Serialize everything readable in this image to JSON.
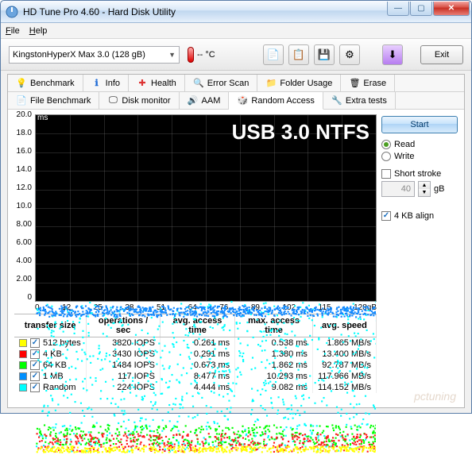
{
  "window": {
    "title": "HD Tune Pro 4.60 - Hard Disk Utility"
  },
  "menu": {
    "file": "File",
    "help": "Help"
  },
  "toolbar": {
    "device": "KingstonHyperX Max 3.0 (128 gB)",
    "temp": "-- °C",
    "exit": "Exit"
  },
  "tabs_row1": [
    {
      "id": "benchmark",
      "label": "Benchmark"
    },
    {
      "id": "info",
      "label": "Info"
    },
    {
      "id": "health",
      "label": "Health"
    },
    {
      "id": "errorscan",
      "label": "Error Scan"
    },
    {
      "id": "folderusage",
      "label": "Folder Usage"
    },
    {
      "id": "erase",
      "label": "Erase"
    }
  ],
  "tabs_row2": [
    {
      "id": "filebench",
      "label": "File Benchmark"
    },
    {
      "id": "diskmon",
      "label": "Disk monitor"
    },
    {
      "id": "aam",
      "label": "AAM"
    },
    {
      "id": "random",
      "label": "Random Access",
      "active": true
    },
    {
      "id": "extra",
      "label": "Extra tests"
    }
  ],
  "side": {
    "start": "Start",
    "read": "Read",
    "write": "Write",
    "short_stroke": "Short stroke",
    "stroke_val": "40",
    "stroke_unit": "gB",
    "align": "4 KB align"
  },
  "chart_data": {
    "type": "scatter",
    "title": "USB 3.0 NTFS",
    "xlabel": "gB",
    "ylabel": "ms",
    "xlim": [
      0,
      128
    ],
    "ylim": [
      0,
      20
    ],
    "xticks": [
      0,
      12,
      25,
      38,
      51,
      64,
      76,
      89,
      102,
      115,
      "128gB"
    ],
    "yticks": [
      0,
      2,
      4,
      6,
      8,
      10,
      12,
      14,
      16,
      18,
      20
    ],
    "series": [
      {
        "name": "512 bytes",
        "color": "#ffff00",
        "band_ms": [
          0.261,
          0.538
        ]
      },
      {
        "name": "4 KB",
        "color": "#ff0000",
        "band_ms": [
          0.291,
          1.38
        ]
      },
      {
        "name": "64 KB",
        "color": "#00ff00",
        "band_ms": [
          0.673,
          1.862
        ]
      },
      {
        "name": "1 MB",
        "color": "#0090ff",
        "band_ms": [
          8.477,
          10.293
        ]
      },
      {
        "name": "Random",
        "color": "#00ffff",
        "band_ms": [
          0.3,
          9.082
        ]
      }
    ]
  },
  "table": {
    "headers": [
      "transfer size",
      "operations / sec",
      "avg. access time",
      "max. access time",
      "avg. speed"
    ],
    "rows": [
      {
        "color": "y",
        "size": "512 bytes",
        "iops": "3820 IOPS",
        "avg": "0.261 ms",
        "max": "0.538 ms",
        "speed": "1.865 MB/s"
      },
      {
        "color": "r",
        "size": "4 KB",
        "iops": "3430 IOPS",
        "avg": "0.291 ms",
        "max": "1.380 ms",
        "speed": "13.400 MB/s"
      },
      {
        "color": "g",
        "size": "64 KB",
        "iops": "1484 IOPS",
        "avg": "0.673 ms",
        "max": "1.862 ms",
        "speed": "92.787 MB/s"
      },
      {
        "color": "b",
        "size": "1 MB",
        "iops": "117 IOPS",
        "avg": "8.477 ms",
        "max": "10.293 ms",
        "speed": "117.966 MB/s"
      },
      {
        "color": "c",
        "size": "Random",
        "iops": "224 IOPS",
        "avg": "4.444 ms",
        "max": "9.082 ms",
        "speed": "114.152 MB/s"
      }
    ]
  },
  "watermark": "pctuning"
}
